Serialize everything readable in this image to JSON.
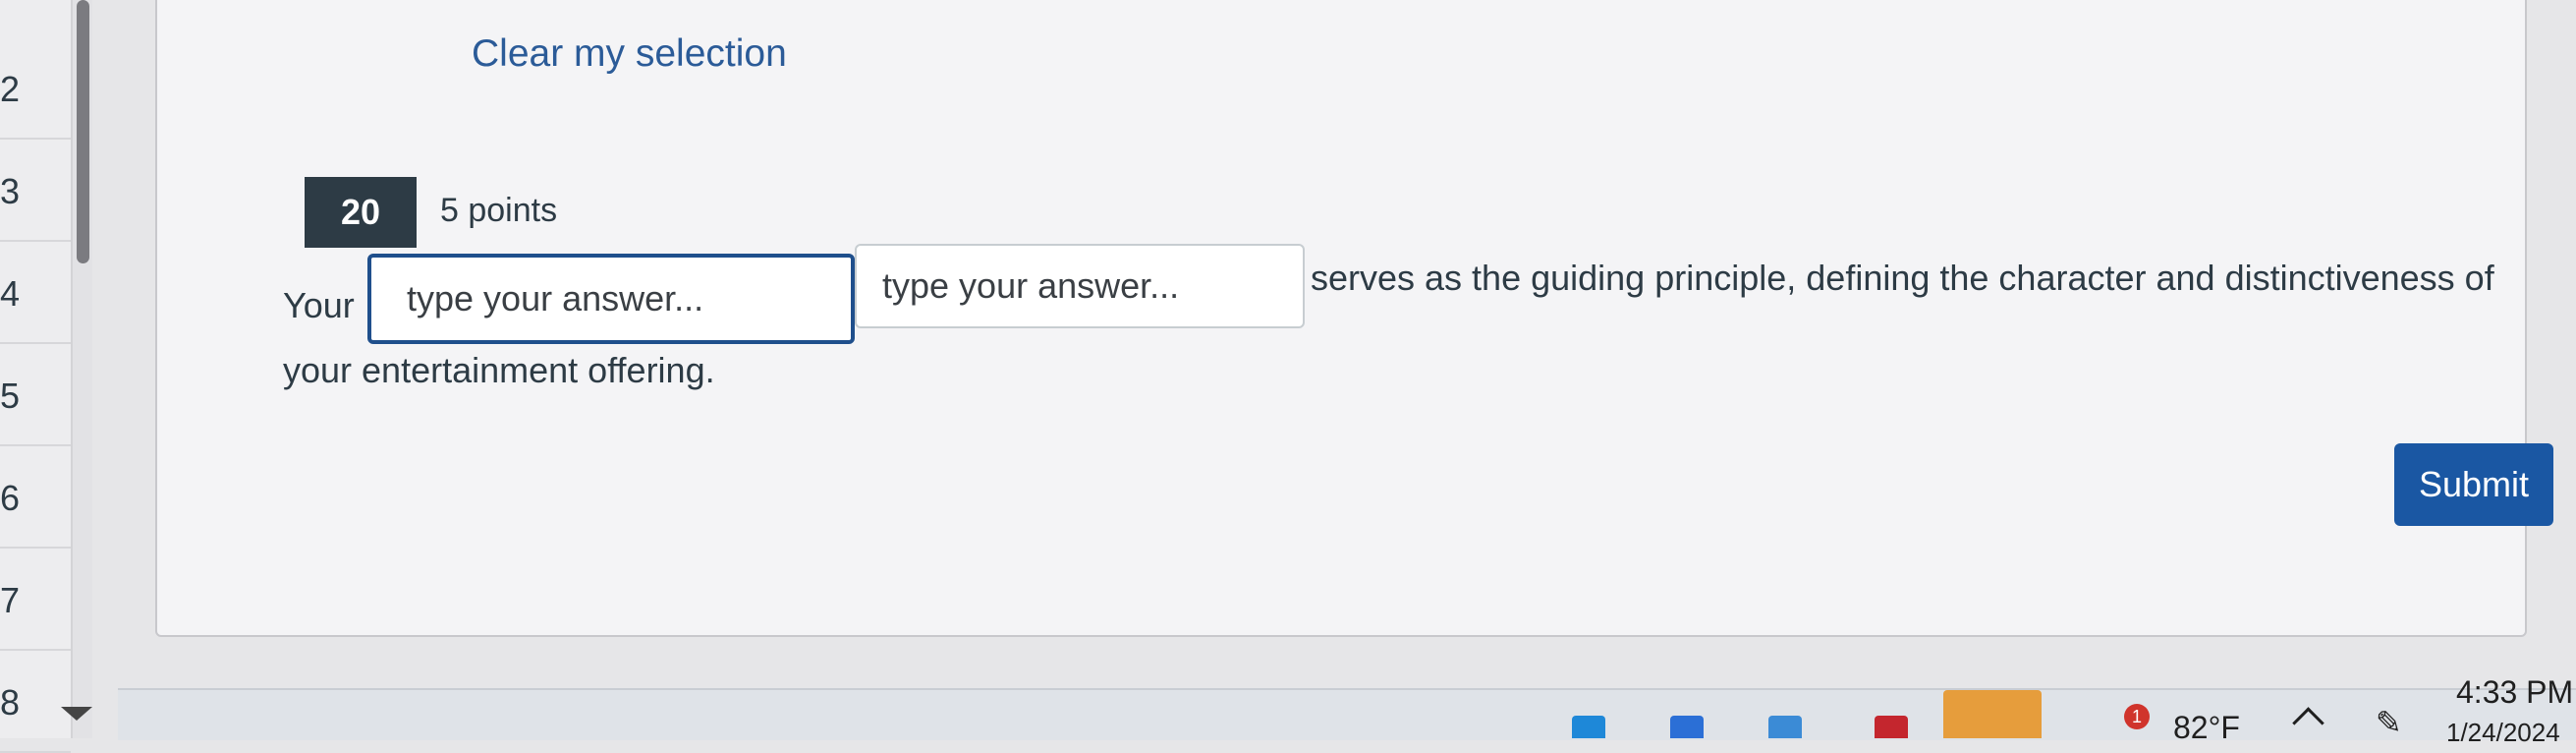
{
  "nav": {
    "numbers": [
      "2",
      "3",
      "4",
      "5",
      "6",
      "7",
      "8"
    ]
  },
  "question": {
    "clear_label": "Clear my selection",
    "number": "20",
    "points": "5 points",
    "text_before": "Your",
    "blank1_placeholder": "type your answer...",
    "blank2_placeholder": "type your answer...",
    "text_after": "serves as the guiding principle, defining the character and distinctiveness of",
    "text_line2": "your entertainment offering.",
    "submit_label": "Submit"
  },
  "taskbar": {
    "notification_count": "1",
    "weather_temp": "82°F",
    "time": "4:33 PM",
    "date": "1/24/2024"
  },
  "colors": {
    "accent": "#1a57a3",
    "link": "#2b5b98",
    "qnum_bg": "#2d3b45"
  },
  "icons": [
    "pin-icon",
    "chevron-up-icon",
    "pen-icon",
    "scroll-down-icon"
  ]
}
